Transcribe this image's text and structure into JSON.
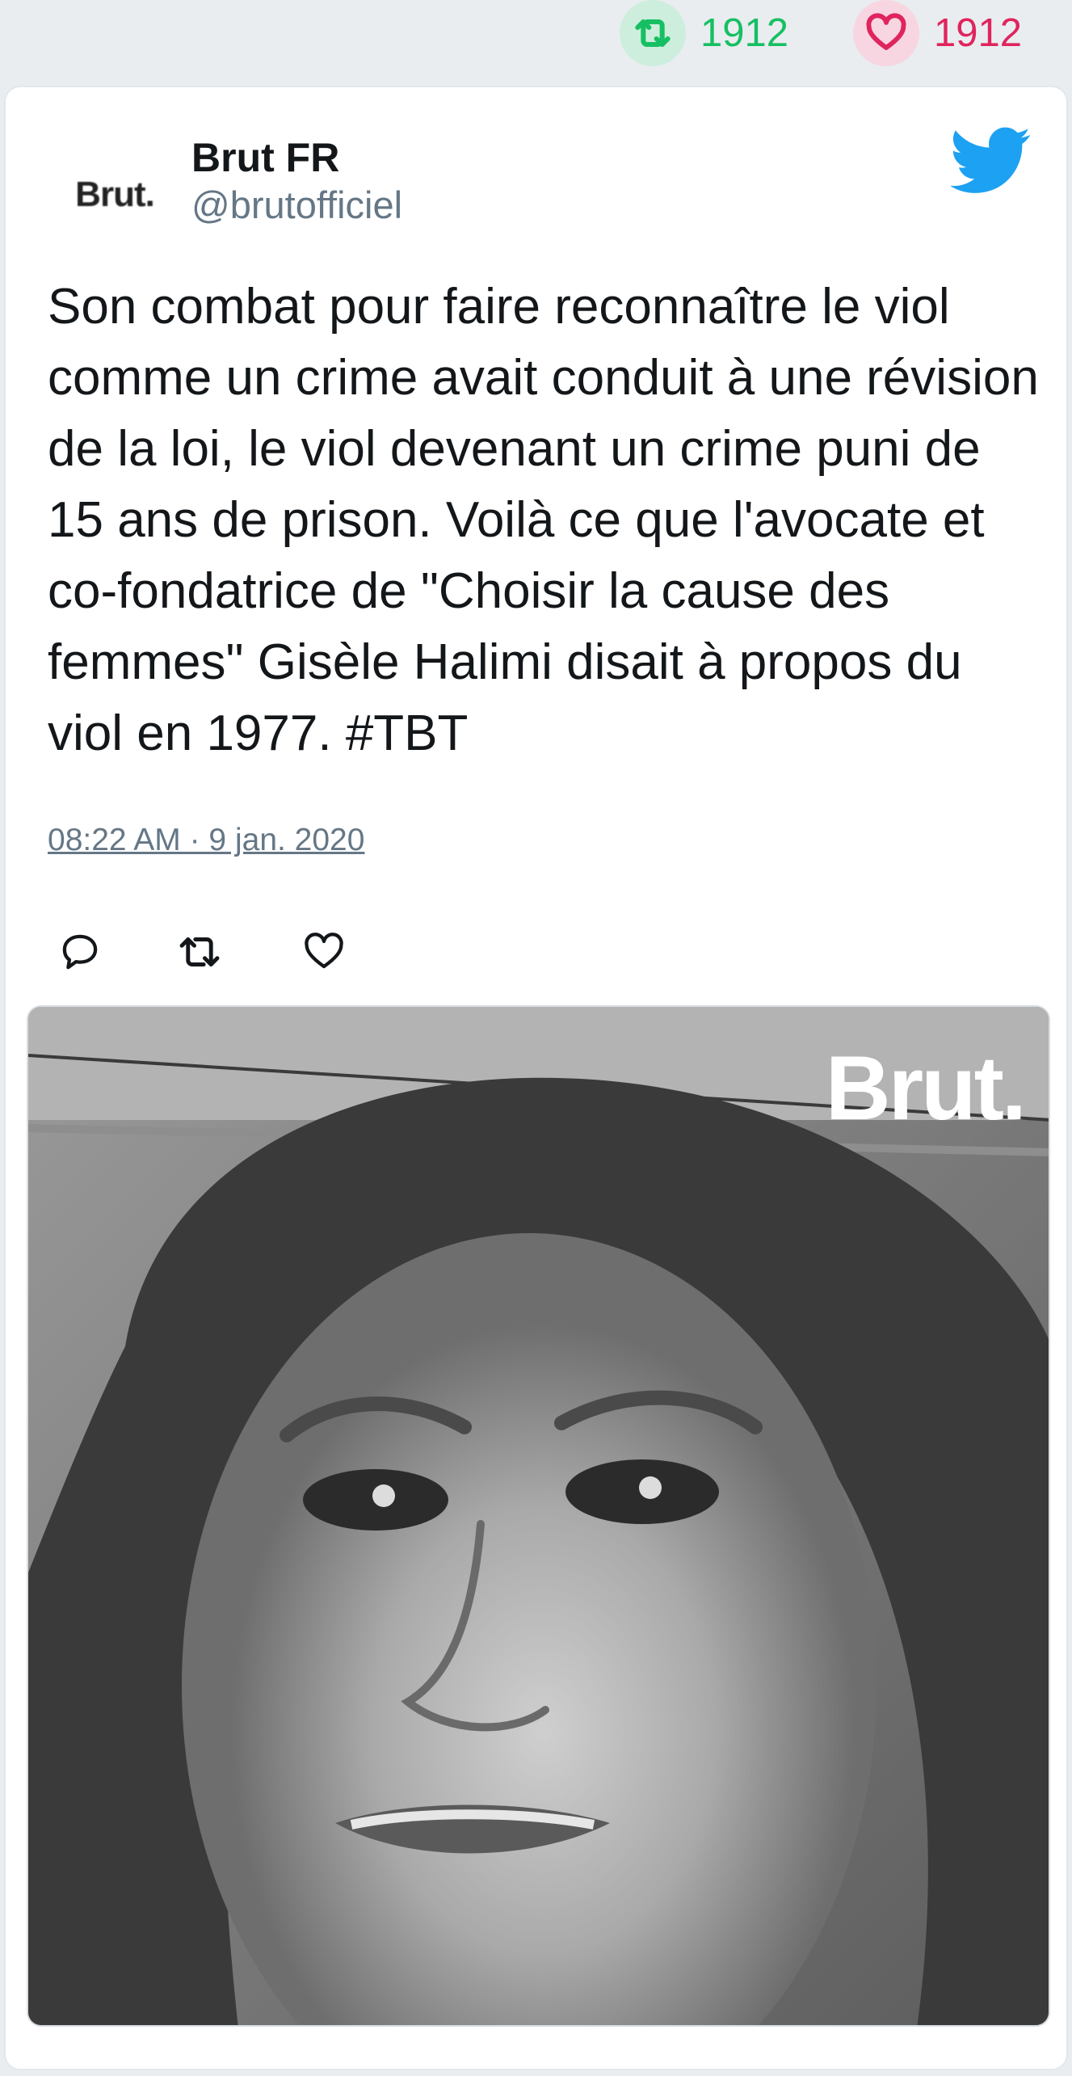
{
  "stats": {
    "retweets": "1912",
    "likes": "1912",
    "retweet_color": "#17bf63",
    "like_color": "#e0245e"
  },
  "tweet": {
    "author_name": "Brut FR",
    "author_handle": "@brutofficiel",
    "avatar_text": "Brut.",
    "text": "Son combat pour faire reconnaître le viol comme un crime avait conduit à une révision de la loi, le viol devenant un crime puni de 15 ans de prison. Voilà ce que l'avocate et co-fondatrice de \"Choisir la cause des femmes\" Gisèle Halimi disait à propos du viol en 1977. #TBT",
    "timestamp": "08:22 AM · 9 jan. 2020",
    "media_watermark": "Brut.",
    "icons": {
      "brand": "twitter-bird-icon",
      "reply": "reply-icon",
      "retweet": "retweet-icon",
      "like": "heart-icon"
    }
  },
  "colors": {
    "twitter_blue": "#1da1f2",
    "text_primary": "#14171a",
    "text_secondary": "#657786"
  }
}
